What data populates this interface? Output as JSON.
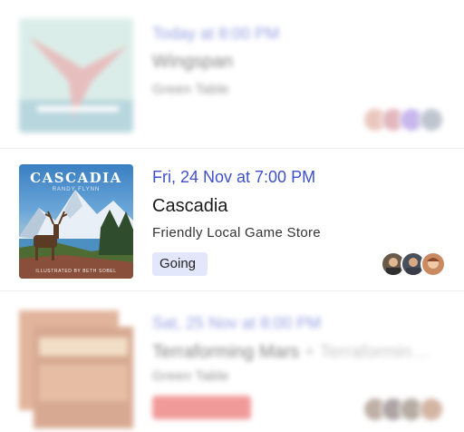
{
  "events": [
    {
      "date": "Today at 8:00 PM",
      "title": "Wingspan",
      "venue": "Green Table",
      "badge": "",
      "avatars": [
        "#d99a8a",
        "#c97e86",
        "#9b7de0",
        "#8c96a8"
      ]
    },
    {
      "date": "Fri, 24 Nov at 7:00 PM",
      "title": "Cascadia",
      "venue": "Friendly Local Game Store",
      "badge": "Going",
      "avatars": [
        "#6a5a4c",
        "#4a4f5c",
        "#c98a62"
      ],
      "cover": {
        "word": "CASCADIA",
        "author": "RANDY FLYNN",
        "credit": "ILLUSTRATED BY BETH SOBEL"
      }
    },
    {
      "date": "Sat, 25 Nov at 8:00 PM",
      "title": "Terraforming Mars",
      "title_suffix": " + Terraformin…",
      "venue": "Green Table",
      "badge": "",
      "avatars": [
        "#8b6f60",
        "#6b5a58",
        "#7b6a5a",
        "#b0795a"
      ]
    }
  ],
  "colors": {
    "accent": "#3f51c9",
    "going_badge_bg": "#e3e7fb",
    "declined_badge_bg": "#e54848"
  }
}
